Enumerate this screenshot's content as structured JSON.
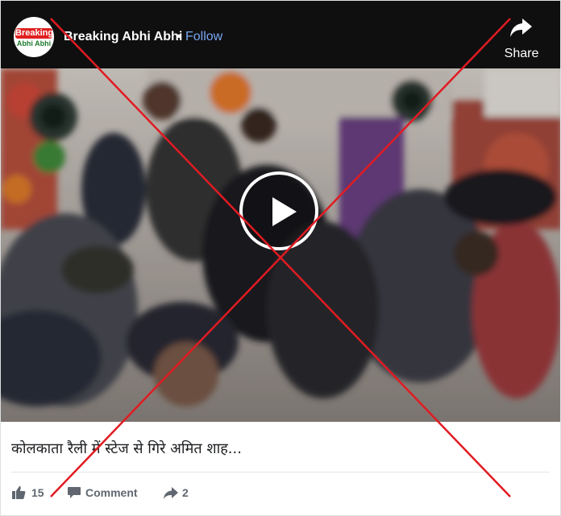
{
  "page": {
    "name": "Breaking Abhi Abhi",
    "separator": "•",
    "follow_label": "Follow",
    "avatar_line1": "Breaking",
    "avatar_line2": "Abhi Abhi"
  },
  "video": {
    "share_label": "Share"
  },
  "post": {
    "caption": "कोलकाता रैली में स्टेज से गिरे अमित शाह..."
  },
  "actions": {
    "like_count": "15",
    "comment_label": "Comment",
    "share_count": "2"
  },
  "colors": {
    "topbar": "#0f0f10",
    "follow_link": "#79a7f0",
    "strike_cross": "#e11b22",
    "text_secondary": "#606770"
  },
  "icons": [
    "share-arrow-icon",
    "play-icon",
    "like-icon",
    "comment-icon",
    "share-icon"
  ]
}
